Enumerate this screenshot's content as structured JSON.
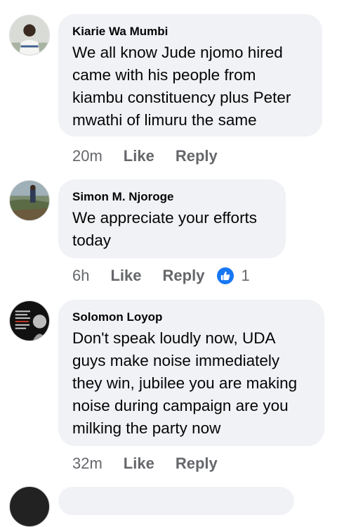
{
  "comments": [
    {
      "author": "Kiarie Wa Mumbi",
      "text": "We all know Jude njomo hired came with his people from kiambu constituency plus Peter mwathi of limuru the same",
      "time": "20m",
      "like_label": "Like",
      "reply_label": "Reply"
    },
    {
      "author": "Simon M. Njoroge",
      "text": "We appreciate your efforts today",
      "time": "6h",
      "like_label": "Like",
      "reply_label": "Reply",
      "reaction_count": "1",
      "reaction_icon": "thumbs-up-icon",
      "reaction_color": "#1877f2"
    },
    {
      "author": "Solomon Loyop",
      "text": "Don't speak loudly now, UDA guys make noise immediately they win, jubilee you are making noise during campaign are you milking the party now",
      "time": "32m",
      "like_label": "Like",
      "reply_label": "Reply"
    }
  ],
  "colors": {
    "bubble": "#f0f2f5",
    "meta_text": "#65676b",
    "body_text": "#050505",
    "like_badge": "#1877f2"
  }
}
